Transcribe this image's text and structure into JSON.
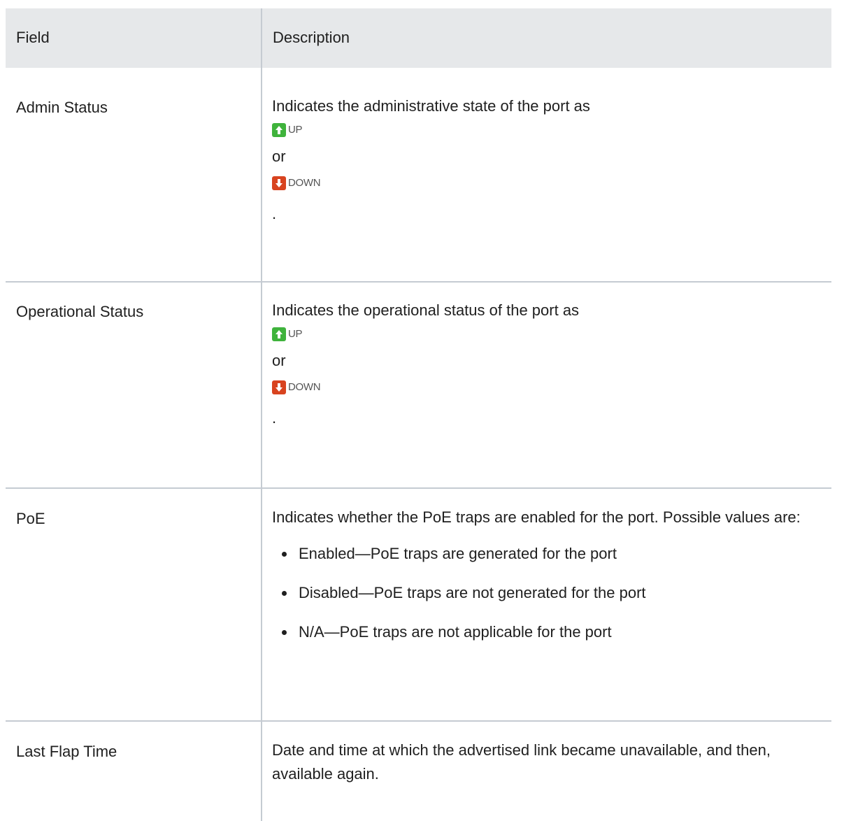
{
  "table": {
    "headers": {
      "field": "Field",
      "description": "Description"
    },
    "rows": [
      {
        "field": "Admin Status",
        "intro": "Indicates the administrative state of the port as",
        "status_up": "UP",
        "or": "or",
        "status_down": "DOWN",
        "period": "."
      },
      {
        "field": "Operational Status",
        "intro": "Indicates the operational status of the port as",
        "status_up": "UP",
        "or": "or",
        "status_down": "DOWN",
        "period": "."
      },
      {
        "field": "PoE",
        "intro": "Indicates whether the PoE traps are enabled for the port. Possible values are:",
        "bullets": [
          "Enabled—PoE traps are generated for the port",
          "Disabled—PoE traps are not generated for the port",
          "N/A—PoE traps are not applicable for the port"
        ]
      },
      {
        "field": "Last Flap Time",
        "intro": "Date and time at which the advertised link became unavailable, and then, available again."
      }
    ]
  },
  "icons": {
    "up": "arrow-up-icon",
    "down": "arrow-down-icon"
  },
  "colors": {
    "header_bg": "#e6e8ea",
    "divider": "#c5cbd2",
    "up": "#3fb33c",
    "down": "#d8431f"
  }
}
